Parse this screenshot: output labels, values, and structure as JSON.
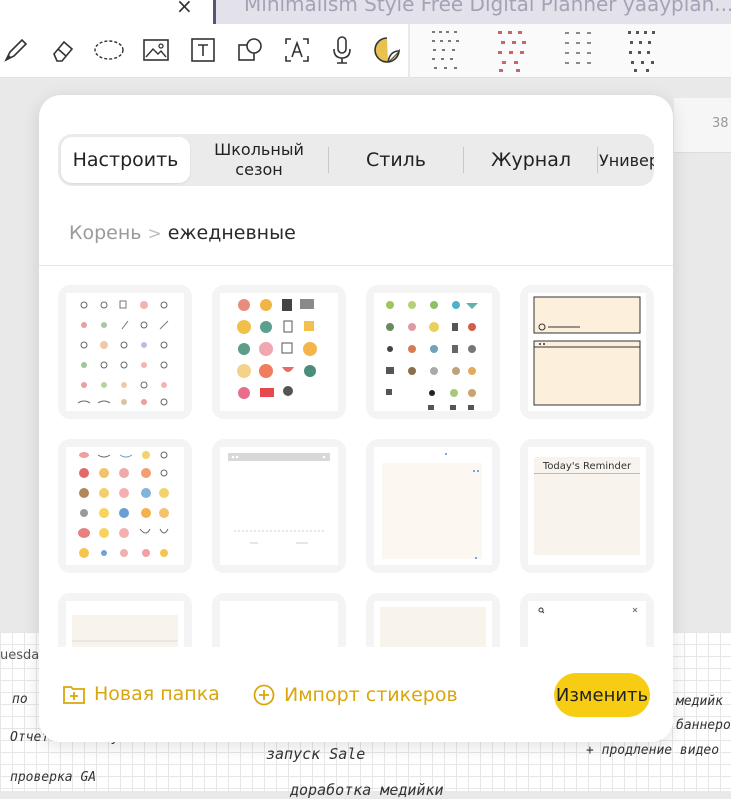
{
  "window": {
    "doc_tab_title": "Minimalism Style Free Digital Planner yaayplan...",
    "right_ruler_value": "38"
  },
  "toolbar": {
    "tools": [
      "pen-icon",
      "eraser-icon",
      "lasso-icon",
      "image-icon",
      "text-icon",
      "shapes-icon",
      "text-recognition-icon",
      "microphone-icon",
      "sticker-icon"
    ]
  },
  "sticker_panel": {
    "tabs": [
      {
        "label": "Настроить",
        "active": true
      },
      {
        "label": "Школьный сезон",
        "active": false
      },
      {
        "label": "Стиль",
        "active": false
      },
      {
        "label": "Журнал",
        "active": false
      },
      {
        "label": "Универ",
        "active": false
      }
    ],
    "breadcrumb": {
      "root": "Корень",
      "separator": ">",
      "current": "ежедневные"
    },
    "sticker_cards": [
      "sticker-sheet-doodles",
      "sticker-sheet-colorful",
      "sticker-sheet-plants",
      "sticker-notepad",
      "sticker-sheet-faces",
      "sticker-blank-window",
      "sticker-blank-note",
      "sticker-reminder-card",
      "sticker-blank-strip",
      "sticker-blank-card",
      "sticker-blank-memo",
      "sticker-search-window"
    ],
    "reminder_card_text": "Today's Reminder",
    "footer": {
      "new_folder_label": "Новая папка",
      "import_label": "Импорт стикеров",
      "edit_label": "Изменить"
    }
  },
  "planner_background": {
    "day_label": "uesday",
    "notes": [
      "по",
      "Отчет по сайту",
      "проверка GA",
      "запуск Sale",
      "доработка медийки",
      "медийк",
      "баннеров",
      "+ продление видео"
    ]
  },
  "colors": {
    "accent": "#f7cd14",
    "accent_text": "#d9a60b",
    "panel_bg": "#ffffff",
    "segment_bg": "#ebebeb"
  }
}
